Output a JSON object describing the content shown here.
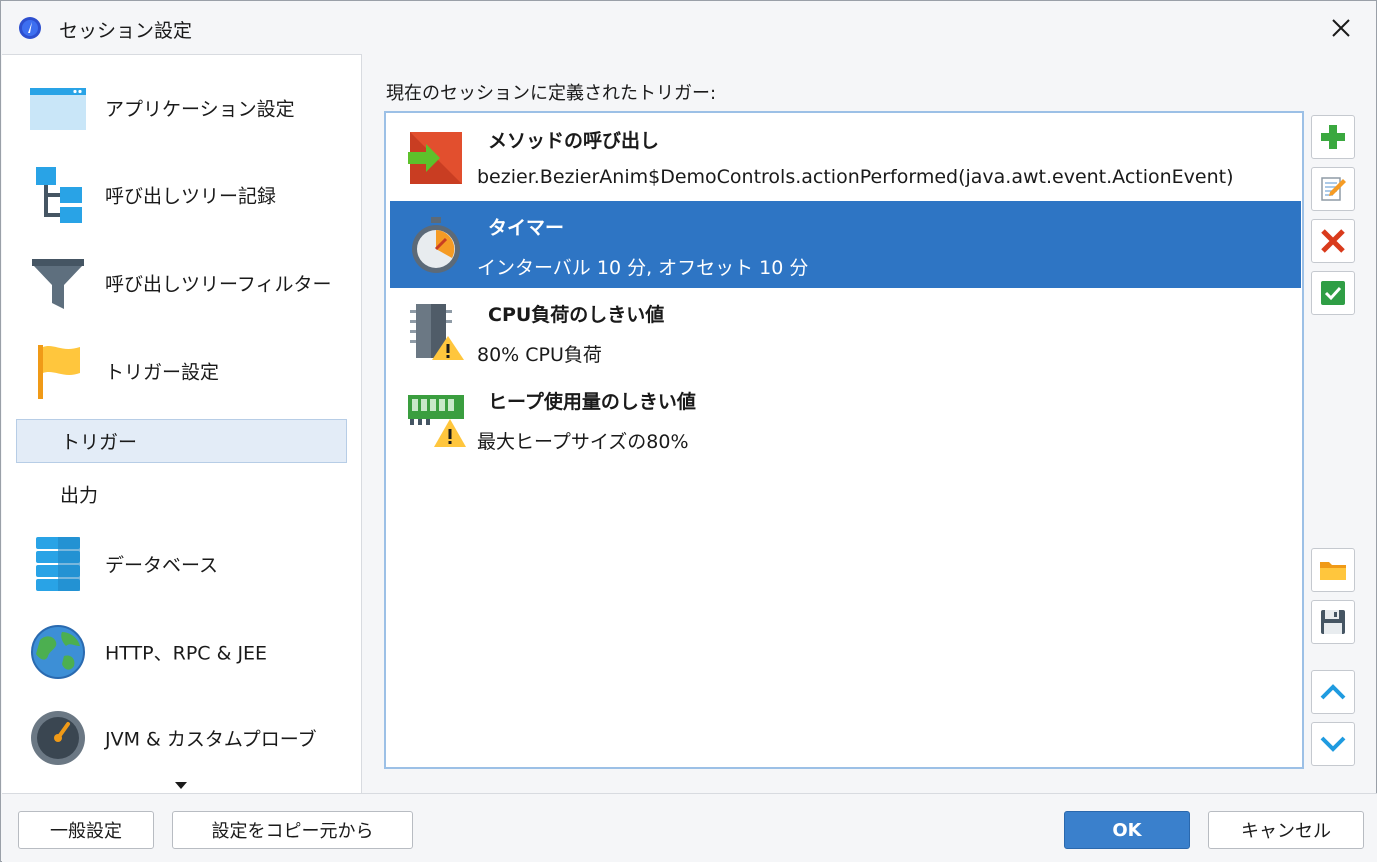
{
  "window": {
    "title": "セッション設定"
  },
  "sidebar": {
    "items": [
      {
        "label": "アプリケーション設定",
        "icon": "app-window-icon"
      },
      {
        "label": "呼び出しツリー記録",
        "icon": "tree-icon"
      },
      {
        "label": "呼び出しツリーフィルター",
        "icon": "funnel-icon"
      },
      {
        "label": "トリガー設定",
        "icon": "flag-icon"
      },
      {
        "label": "データベース",
        "icon": "database-icon"
      },
      {
        "label": "HTTP、RPC & JEE",
        "icon": "globe-icon"
      },
      {
        "label": "JVM & カスタムプローブ",
        "icon": "gauge-icon"
      }
    ],
    "subitems": [
      {
        "label": "トリガー",
        "selected": true
      },
      {
        "label": "出力",
        "selected": false
      }
    ]
  },
  "content": {
    "caption": "現在のセッションに定義されたトリガー:",
    "triggers": [
      {
        "title": "メソッドの呼び出し",
        "desc": "bezier.BezierAnim$DemoControls.actionPerformed(java.awt.event.ActionEvent)",
        "icon": "method-call-icon",
        "selected": false
      },
      {
        "title": "タイマー",
        "desc": "インターバル 10 分, オフセット 10 分",
        "icon": "stopwatch-icon",
        "selected": true
      },
      {
        "title": "CPU負荷のしきい値",
        "desc": "80% CPU負荷",
        "icon": "cpu-warning-icon",
        "selected": false
      },
      {
        "title": "ヒープ使用量のしきい値",
        "desc": "最大ヒープサイズの80%",
        "icon": "memory-warning-icon",
        "selected": false
      }
    ]
  },
  "footer": {
    "general_settings": "一般設定",
    "copy_settings": "設定をコピー元から",
    "ok": "OK",
    "cancel": "キャンセル"
  },
  "colors": {
    "selection": "#2e75c4",
    "accent": "#3a80cc"
  }
}
